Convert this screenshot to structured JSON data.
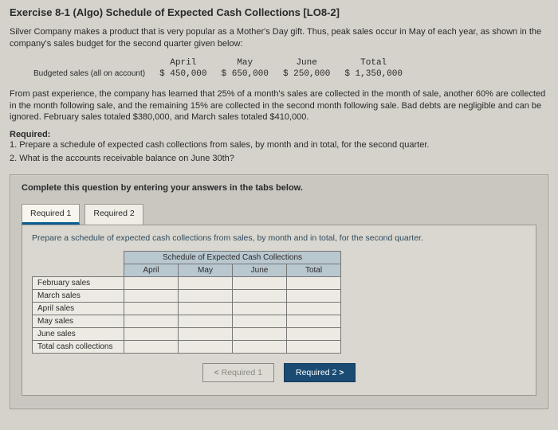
{
  "title": "Exercise 8-1 (Algo) Schedule of Expected Cash Collections [LO8-2]",
  "intro": "Silver Company makes a product that is very popular as a Mother's Day gift. Thus, peak sales occur in May of each year, as shown in the company's sales budget for the second quarter given below:",
  "budget": {
    "row_label": "Budgeted sales (all on account)",
    "cols": {
      "april": {
        "label": "April",
        "value": "$ 450,000"
      },
      "may": {
        "label": "May",
        "value": "$ 650,000"
      },
      "june": {
        "label": "June",
        "value": "$ 250,000"
      },
      "total": {
        "label": "Total",
        "value": "$ 1,350,000"
      }
    }
  },
  "experience": "From past experience, the company has learned that 25% of a month's sales are collected in the month of sale, another 60% are collected in the month following sale, and the remaining 15% are collected in the second month following sale. Bad debts are negligible and can be ignored. February sales totaled $380,000, and March sales totaled $410,000.",
  "required_label": "Required:",
  "required_1": "1. Prepare a schedule of expected cash collections from sales, by month and in total, for the second quarter.",
  "required_2": "2. What is the accounts receivable balance on June 30th?",
  "panel_instr": "Complete this question by entering your answers in the tabs below.",
  "tabs": {
    "t1": "Required 1",
    "t2": "Required 2"
  },
  "tab1_desc": "Prepare a schedule of expected cash collections from sales, by month and in total, for the second quarter.",
  "sched": {
    "title": "Schedule of Expected Cash Collections",
    "headers": {
      "april": "April",
      "may": "May",
      "june": "June",
      "total": "Total"
    },
    "rows": {
      "feb": "February sales",
      "mar": "March sales",
      "apr": "April sales",
      "may": "May sales",
      "jun": "June sales",
      "tot": "Total cash collections"
    }
  },
  "nav": {
    "prev": "Required 1",
    "next": "Required 2"
  }
}
